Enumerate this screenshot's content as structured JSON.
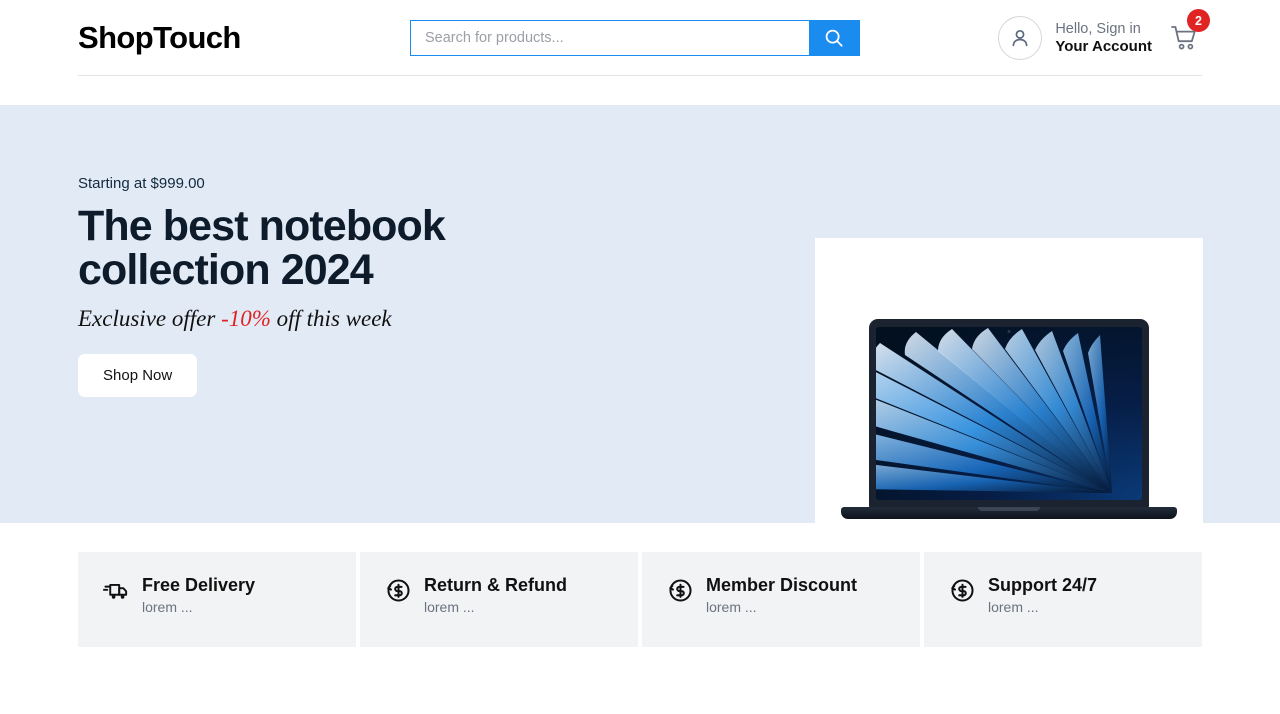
{
  "header": {
    "logo": "ShopTouch",
    "search": {
      "placeholder": "Search for products...",
      "value": "",
      "button_icon": "search-icon"
    },
    "account": {
      "avatar_icon": "user-avatar-icon",
      "greeting": "Hello, Sign in",
      "name": "Your Account"
    },
    "cart": {
      "icon": "shopping-cart-icon",
      "count": "2",
      "badge_color": "#e02424"
    },
    "accent_color": "#1a8cf0"
  },
  "hero": {
    "eyebrow": "Starting at $999.00",
    "title_line1": "The best notebook",
    "title_line2": "collection 2024",
    "subtitle_prefix": "Exclusive offer ",
    "subtitle_discount": "-10%",
    "subtitle_suffix": " off this week",
    "cta_label": "Shop Now",
    "background_color": "#e2ebf5",
    "discount_color": "#e02424",
    "product_image": "macbook-air-midnight"
  },
  "features": [
    {
      "icon": "delivery-truck-icon",
      "title": "Free Delivery",
      "desc": "lorem ..."
    },
    {
      "icon": "refund-dollar-icon",
      "title": "Return & Refund",
      "desc": "lorem ..."
    },
    {
      "icon": "refund-dollar-icon",
      "title": "Member Discount",
      "desc": "lorem ..."
    },
    {
      "icon": "refund-dollar-icon",
      "title": "Support 24/7",
      "desc": "lorem ..."
    }
  ]
}
